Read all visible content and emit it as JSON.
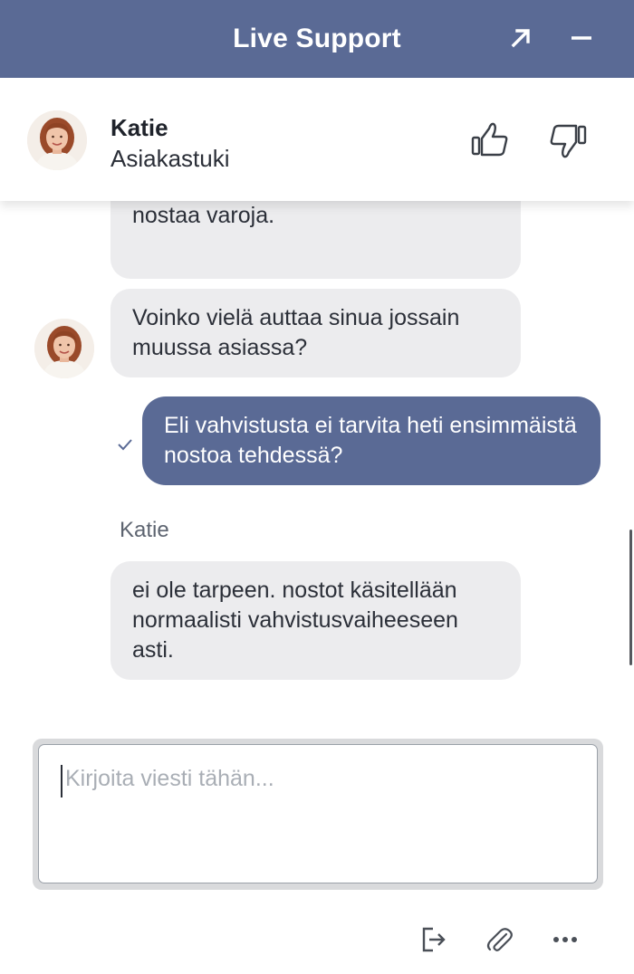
{
  "window": {
    "title": "Live Support",
    "expand_icon": "arrow-up-right-icon",
    "minimize_icon": "minus-icon",
    "header_color": "#5a6a95"
  },
  "agent": {
    "name": "Katie",
    "role": "Asiakastuki",
    "avatar_icon": "agent-photo"
  },
  "rating": {
    "thumbs_up_icon": "thumbs-up-icon",
    "thumbs_down_icon": "thumbs-down-icon"
  },
  "messages": [
    {
      "from": "agent",
      "text": "rajoituksia, tehdä talletuksia ja nostaa varoja."
    },
    {
      "from": "agent",
      "text": "Voinko vielä auttaa sinua jossain muussa asiassa?"
    },
    {
      "from": "user",
      "text": "Eli vahvistusta ei tarvita heti ensimmäistä nostoa tehdessä?",
      "status_icon": "checkmark-icon"
    },
    {
      "from": "agent",
      "sender": "Katie",
      "text": "ei ole tarpeen. nostot käsitellään normaalisti vahvistusvaiheeseen asti."
    }
  ],
  "composer": {
    "placeholder": "Kirjoita viesti tähän..."
  },
  "footer": {
    "exit_icon": "exit-icon",
    "attach_icon": "paperclip-icon",
    "more_icon": "more-dots-icon"
  },
  "colors": {
    "agent_bubble": "#ececee",
    "user_bubble": "#5a6a95"
  }
}
